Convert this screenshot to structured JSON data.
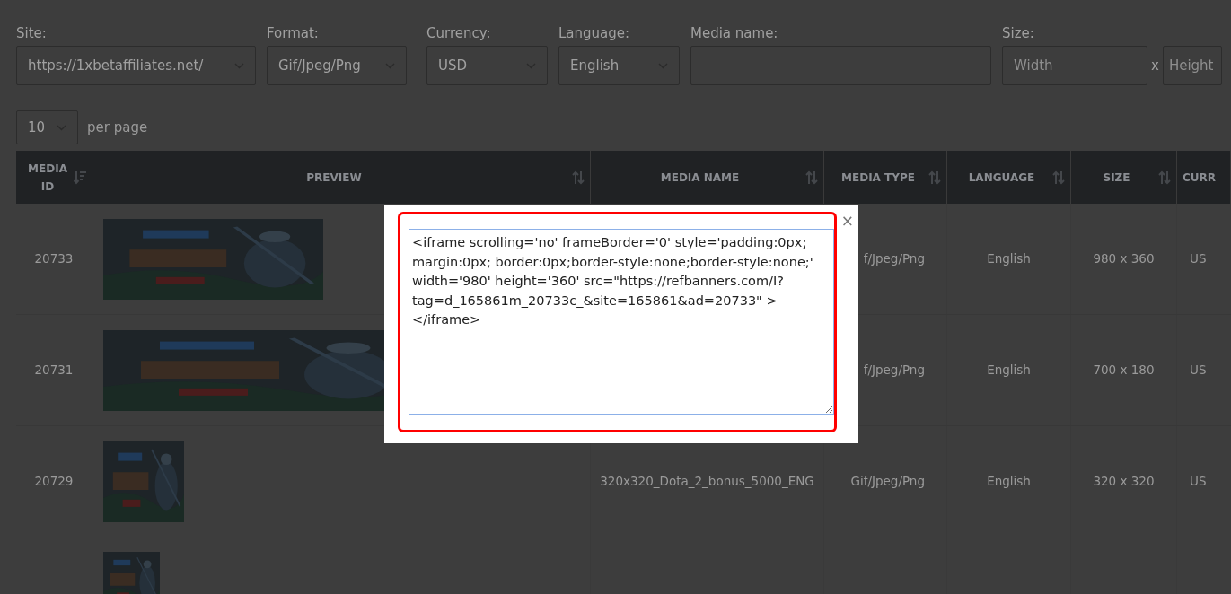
{
  "filters": [
    {
      "kind": "select",
      "label": "Site:",
      "value": "https://1xbetaffiliates.net/"
    },
    {
      "kind": "select",
      "label": "Format:",
      "value": "Gif/Jpeg/Png"
    },
    {
      "kind": "select",
      "label": "Currency:",
      "value": "USD"
    },
    {
      "kind": "select",
      "label": "Language:",
      "value": "English"
    },
    {
      "kind": "text",
      "label": "Media name:"
    },
    {
      "kind": "size",
      "label": "Size:",
      "separator": "x",
      "fields": [
        {
          "placeholder": "Width"
        },
        {
          "placeholder": "Height"
        }
      ]
    }
  ],
  "per_page": {
    "value": "10",
    "label": "per page"
  },
  "table": {
    "columns": [
      {
        "label": "MEDIA ID",
        "sorted": true
      },
      {
        "label": "PREVIEW",
        "sorted": false
      },
      {
        "label": "MEDIA NAME",
        "sorted": false
      },
      {
        "label": "MEDIA TYPE",
        "sorted": false
      },
      {
        "label": "LANGUAGE",
        "sorted": false
      },
      {
        "label": "SIZE",
        "sorted": false
      },
      {
        "label": "CURR"
      }
    ],
    "rows": [
      {
        "media_id": "20733",
        "preview": {
          "kind": "picture"
        },
        "media_type": "f/Jpeg/Png",
        "language": "English",
        "size": "980 x 360",
        "currency": "US"
      },
      {
        "media_id": "20731",
        "preview": {
          "kind": "picture"
        },
        "media_type": "f/Jpeg/Png",
        "language": "English",
        "size": "700 x 180",
        "currency": "US"
      },
      {
        "media_id": "20729",
        "preview": {
          "kind": "picture"
        },
        "media_name": "320x320_Dota_2_bonus_5000_ENG",
        "media_type": "Gif/Jpeg/Png",
        "language": "English",
        "size": "320 x 320",
        "currency": "US"
      },
      {
        "preview": {
          "kind": "picture"
        }
      }
    ]
  },
  "modal": {
    "close": "×",
    "code": "<iframe scrolling='no' frameBorder='0' style='padding:0px; margin:0px; border:0px;border-style:none;border-style:none;' width='980' height='360' src=\"https://refbanners.com/I?tag=d_165861m_20733c_&site=165861&ad=20733\" ></iframe>",
    "highlighted": true
  }
}
